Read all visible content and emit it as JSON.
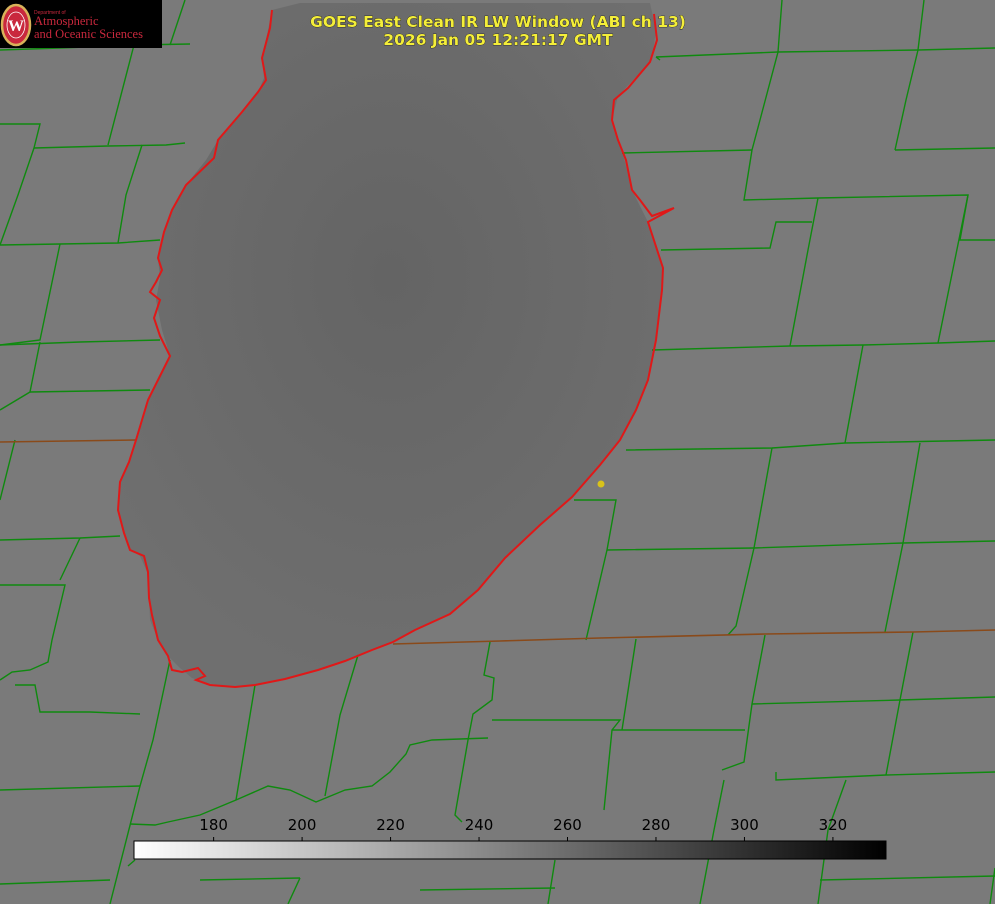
{
  "title": {
    "line1": "GOES East Clean IR LW Window (ABI ch 13)",
    "line2": "2026 Jan 05 12:21:17 GMT"
  },
  "logo": {
    "small_text": "Department of",
    "line1": "Atmospheric",
    "line2": "and Oceanic Sciences",
    "emblem_letter": "W"
  },
  "colorbar": {
    "ticks": [
      "180",
      "200",
      "220",
      "240",
      "260",
      "280",
      "300",
      "320"
    ],
    "range": [
      162,
      332
    ],
    "colormap": "white-to-black"
  },
  "colors": {
    "background": "#7a7a7a",
    "lake": "#6b6b6b",
    "county_lines": "#0f8a0f",
    "shoreline": "#e01818",
    "title_text": "#f4ee3a",
    "marker": "#d8c21a"
  },
  "marker": {
    "label": "",
    "color": "#d8c21a"
  }
}
